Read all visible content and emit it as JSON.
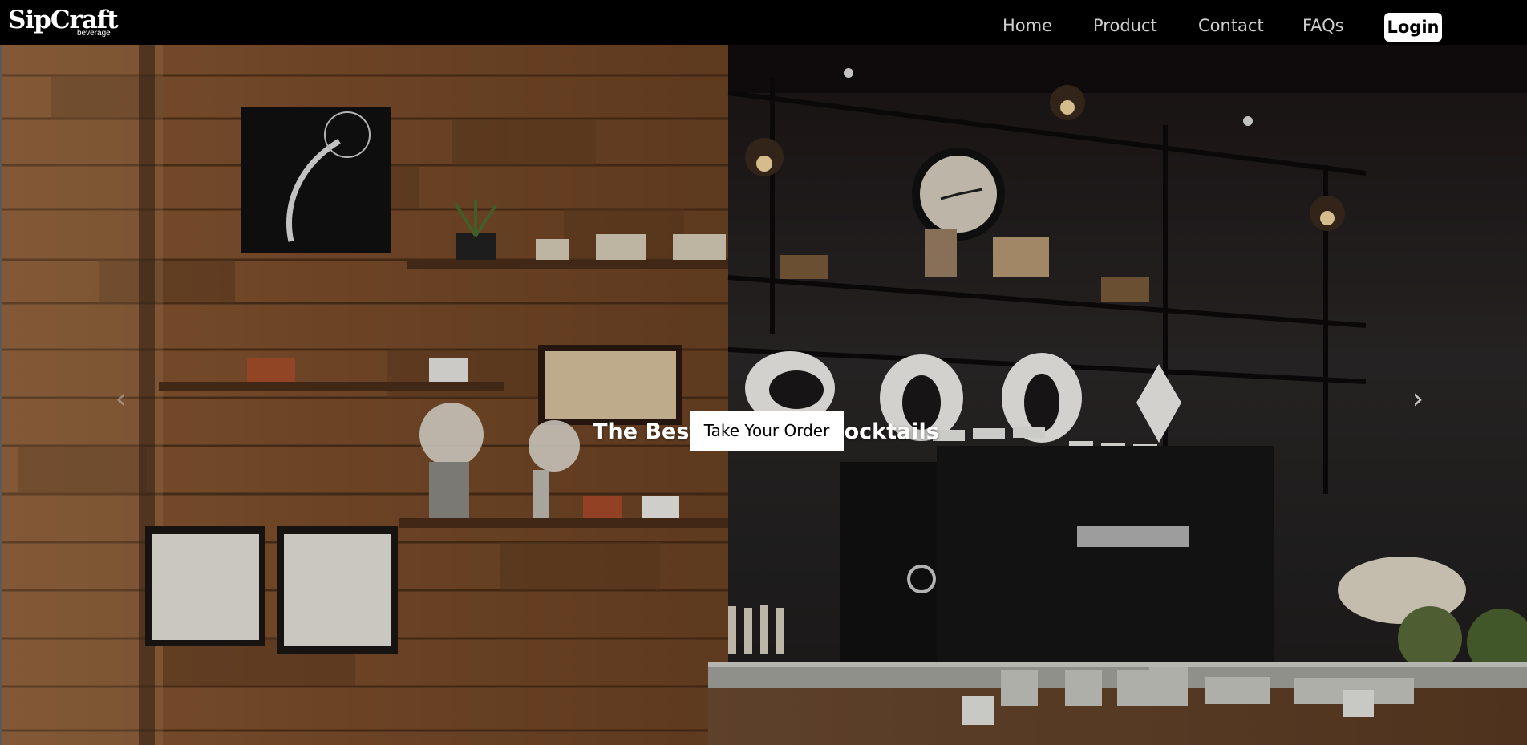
{
  "brand": {
    "name": "SipCraft",
    "tagline": "beverage"
  },
  "nav": {
    "items": [
      {
        "label": "Home"
      },
      {
        "label": "Product"
      },
      {
        "label": "Contact"
      },
      {
        "label": "FAQs"
      }
    ],
    "login_label": "Login"
  },
  "hero": {
    "title": "The Best quality of cocktails",
    "cta_label": "Take Your Order",
    "prev_icon": "chevron-left-icon",
    "next_icon": "chevron-right-icon",
    "prev_glyph": "‹",
    "next_glyph": "›"
  },
  "colors": {
    "navbar_bg": "#000000",
    "login_bg": "#ffffff",
    "cta_bg": "#ffffff"
  }
}
